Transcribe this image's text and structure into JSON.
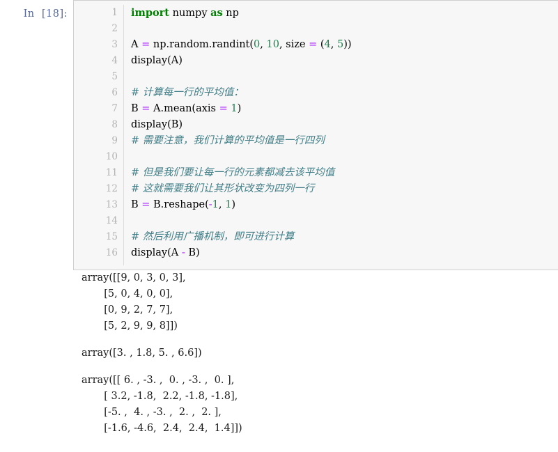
{
  "cell": {
    "prompt_label": "In  [18]:",
    "execution_count": "18",
    "line_numbers": [
      "1",
      "2",
      "3",
      "4",
      "5",
      "6",
      "7",
      "8",
      "9",
      "10",
      "11",
      "12",
      "13",
      "14",
      "15",
      "16"
    ],
    "code_lines": [
      {
        "n": "1",
        "tokens": [
          {
            "t": "import",
            "c": "kw"
          },
          {
            "t": " numpy ",
            "c": "plain"
          },
          {
            "t": "as",
            "c": "kw"
          },
          {
            "t": " np",
            "c": "plain"
          }
        ]
      },
      {
        "n": "2",
        "tokens": []
      },
      {
        "n": "3",
        "tokens": [
          {
            "t": "A ",
            "c": "plain"
          },
          {
            "t": "=",
            "c": "op"
          },
          {
            "t": " np.random.randint(",
            "c": "plain"
          },
          {
            "t": "0",
            "c": "num"
          },
          {
            "t": ", ",
            "c": "plain"
          },
          {
            "t": "10",
            "c": "num"
          },
          {
            "t": ", size ",
            "c": "plain"
          },
          {
            "t": "=",
            "c": "op"
          },
          {
            "t": " (",
            "c": "plain"
          },
          {
            "t": "4",
            "c": "num"
          },
          {
            "t": ", ",
            "c": "plain"
          },
          {
            "t": "5",
            "c": "num"
          },
          {
            "t": "))",
            "c": "plain"
          }
        ]
      },
      {
        "n": "4",
        "tokens": [
          {
            "t": "display(A)",
            "c": "plain"
          }
        ]
      },
      {
        "n": "5",
        "tokens": []
      },
      {
        "n": "6",
        "tokens": [
          {
            "t": "# 计算每一行的平均值：",
            "c": "cmt"
          }
        ]
      },
      {
        "n": "7",
        "tokens": [
          {
            "t": "B ",
            "c": "plain"
          },
          {
            "t": "=",
            "c": "op"
          },
          {
            "t": " A.mean(axis ",
            "c": "plain"
          },
          {
            "t": "=",
            "c": "op"
          },
          {
            "t": " ",
            "c": "plain"
          },
          {
            "t": "1",
            "c": "num"
          },
          {
            "t": ")",
            "c": "plain"
          }
        ]
      },
      {
        "n": "8",
        "tokens": [
          {
            "t": "display(B)",
            "c": "plain"
          }
        ]
      },
      {
        "n": "9",
        "tokens": [
          {
            "t": "# 需要注意，我们计算的平均值是一行四列",
            "c": "cmt"
          }
        ]
      },
      {
        "n": "10",
        "tokens": []
      },
      {
        "n": "11",
        "tokens": [
          {
            "t": "# 但是我们要让每一行的元素都减去该平均值",
            "c": "cmt"
          }
        ]
      },
      {
        "n": "12",
        "tokens": [
          {
            "t": "# 这就需要我们让其形状改变为四列一行",
            "c": "cmt"
          }
        ]
      },
      {
        "n": "13",
        "tokens": [
          {
            "t": "B ",
            "c": "plain"
          },
          {
            "t": "=",
            "c": "op"
          },
          {
            "t": " B.reshape(",
            "c": "plain"
          },
          {
            "t": "-",
            "c": "op"
          },
          {
            "t": "1",
            "c": "num"
          },
          {
            "t": ", ",
            "c": "plain"
          },
          {
            "t": "1",
            "c": "num"
          },
          {
            "t": ")",
            "c": "plain"
          }
        ]
      },
      {
        "n": "14",
        "tokens": []
      },
      {
        "n": "15",
        "tokens": [
          {
            "t": "# 然后利用广播机制，即可进行计算",
            "c": "cmt"
          }
        ]
      },
      {
        "n": "16",
        "tokens": [
          {
            "t": "display(A ",
            "c": "plain"
          },
          {
            "t": "-",
            "c": "op"
          },
          {
            "t": " B)",
            "c": "plain"
          }
        ]
      }
    ]
  },
  "outputs": [
    {
      "name": "array-A",
      "text": "array([[9, 0, 3, 0, 3],\n       [5, 0, 4, 0, 0],\n       [0, 9, 2, 7, 7],\n       [5, 2, 9, 9, 8]])"
    },
    {
      "name": "array-B-mean",
      "text": "array([3. , 1.8, 5. , 6.6])"
    },
    {
      "name": "array-A-minus-B",
      "text": "array([[ 6. , -3. ,  0. , -3. ,  0. ],\n       [ 3.2, -1.8,  2.2, -1.8, -1.8],\n       [-5. ,  4. , -3. ,  2. ,  2. ],\n       [-1.6, -4.6,  2.4,  2.4,  1.4]])"
    }
  ],
  "arrays": {
    "A": [
      [
        9,
        0,
        3,
        0,
        3
      ],
      [
        5,
        0,
        4,
        0,
        0
      ],
      [
        0,
        9,
        2,
        7,
        7
      ],
      [
        5,
        2,
        9,
        9,
        8
      ]
    ],
    "B_mean": [
      3.0,
      1.8,
      5.0,
      6.6
    ],
    "A_minus_B": [
      [
        6.0,
        -3.0,
        0.0,
        -3.0,
        0.0
      ],
      [
        3.2,
        -1.8,
        2.2,
        -1.8,
        -1.8
      ],
      [
        -5.0,
        4.0,
        -3.0,
        2.0,
        2.0
      ],
      [
        -1.6,
        -4.6,
        2.4,
        2.4,
        1.4
      ]
    ]
  },
  "colors": {
    "keyword": "#008000",
    "operator": "#aa22ff",
    "number": "#208050",
    "comment": "#417e87",
    "prompt": "#5a6a9a",
    "cell_bg": "#f7f7f7",
    "cell_border": "#cfcfcf",
    "gutter_text": "#b3b3b3"
  }
}
